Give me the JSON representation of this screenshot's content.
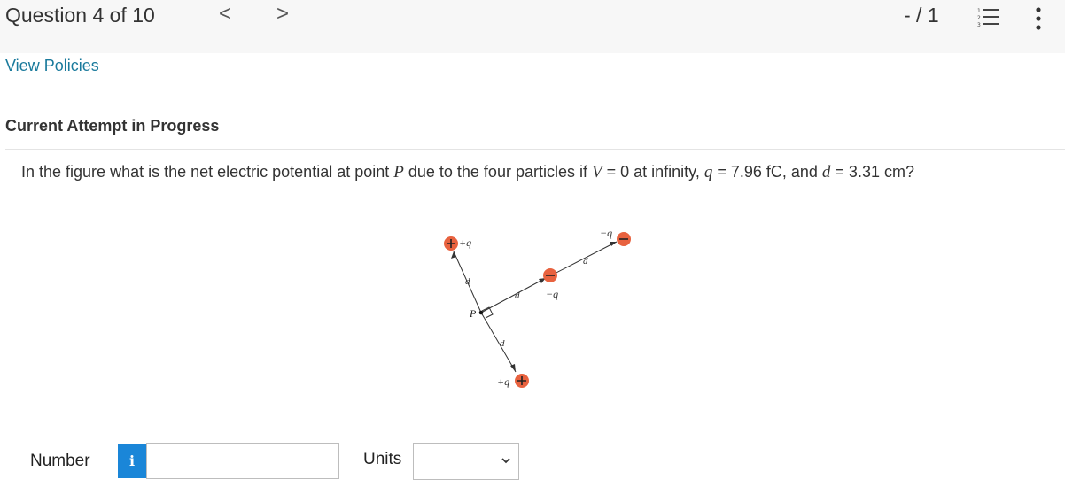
{
  "header": {
    "title": "Question 4 of 10",
    "prev_glyph": "<",
    "next_glyph": ">",
    "score": "- / 1",
    "icons": [
      "numbered-list-icon",
      "more-vertical-icon"
    ]
  },
  "policies_link": "View Policies",
  "attempt_heading": "Current Attempt in Progress",
  "question": {
    "t1": "In the figure what is the net electric potential at point ",
    "var_p": "P",
    "t2": " due to the four particles if ",
    "var_v": "V",
    "t3": " = 0 at infinity, ",
    "var_q": "q",
    "t4": " = 7.96 fC, and ",
    "var_d": "d",
    "t5": " = 3.31 cm?"
  },
  "figure": {
    "label_top_plus": "+q",
    "label_bottom_plus": "+q",
    "label_mid_minus": "−q",
    "label_far_minus": "−q",
    "label_point": "P",
    "label_d1": "d",
    "label_d2": "d",
    "label_d3": "d",
    "label_d4": "d",
    "plus_color": "#e8623f",
    "minus_color": "#e8623f"
  },
  "answer": {
    "number_label": "Number",
    "info_glyph": "i",
    "number_value": "",
    "units_label": "Units",
    "units_selected": ""
  }
}
